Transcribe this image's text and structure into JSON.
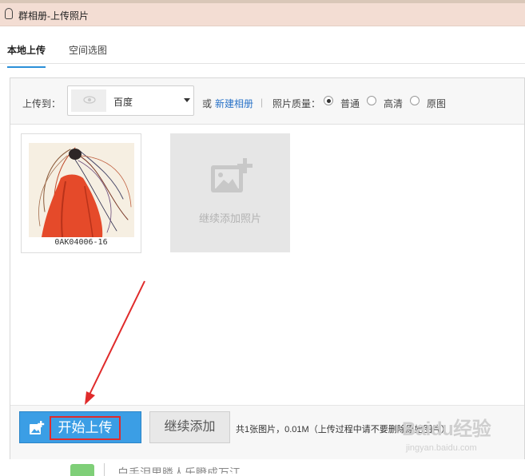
{
  "window": {
    "title": "群相册-上传照片"
  },
  "tabs": [
    {
      "label": "本地上传",
      "active": true
    },
    {
      "label": "空间选图",
      "active": false
    }
  ],
  "options": {
    "upload_to_label": "上传到：",
    "album_name": "百度",
    "or_label": "或",
    "new_album_link": "新建相册",
    "quality_label": "照片质量：",
    "quality_options": [
      "普通",
      "高清",
      "原图"
    ],
    "quality_selected": "普通"
  },
  "photos": [
    {
      "filename": "0AK04006-16"
    }
  ],
  "add_more_card": {
    "label": "继续添加照片"
  },
  "footer": {
    "start_upload_label": "开始上传",
    "continue_add_label": "继续添加",
    "status": "共1张图片，0.01M（上传过程中请不要删除原始图片）"
  },
  "watermark": {
    "brand": "Baidu经验",
    "url": "jingyan.baidu.com"
  },
  "bottom_fragment": {
    "text": "白手泪里膦人乐瞪成万江"
  },
  "colors": {
    "accent": "#3b9ee5",
    "annotation_red": "#e02b2b",
    "title_bg": "#f3ddd3"
  }
}
